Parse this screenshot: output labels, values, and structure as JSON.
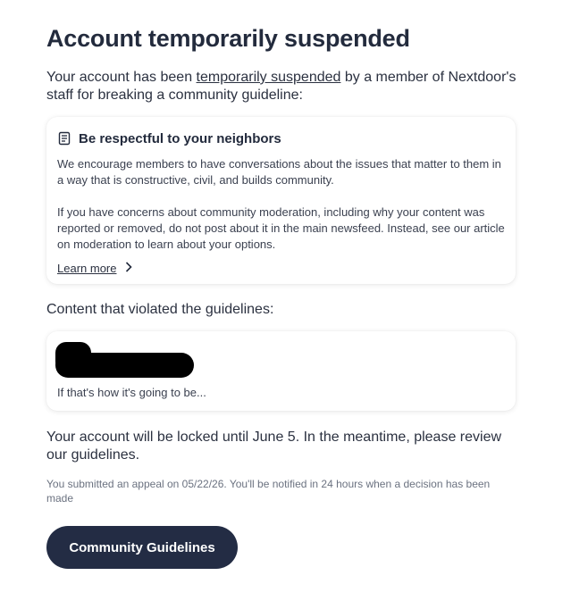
{
  "page": {
    "title": "Account temporarily suspended",
    "intro_before": "Your account has been ",
    "intro_link": "temporarily suspended",
    "intro_after": " by a member of Nextdoor's staff for breaking a community guideline:"
  },
  "guideline_card": {
    "icon": "document-icon",
    "title": "Be respectful to your neighbors",
    "paragraph1": "We encourage members to have conversations about the issues that matter to them in a way that is constructive, civil, and builds community.",
    "paragraph2": "If you have concerns about community moderation, including why your content was reported or removed, do not post about it in the main newsfeed. Instead, see our article on moderation to learn about your options.",
    "learn_more": "Learn more"
  },
  "violation": {
    "label": "Content that violated the guidelines:",
    "text": "If that's how it's going to be..."
  },
  "locked_text": "Your account will be locked until June 5. In the meantime, please review our guidelines.",
  "appeal_text": "You submitted an appeal on 05/22/26. You'll be notified in 24 hours when a decision has been made",
  "button": {
    "label": "Community Guidelines"
  },
  "colors": {
    "button_bg": "#232c44",
    "title": "#232b3d"
  }
}
